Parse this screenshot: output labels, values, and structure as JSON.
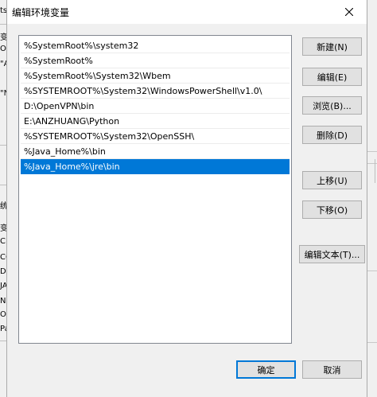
{
  "dialog": {
    "title": "编辑环境变量"
  },
  "paths": [
    "%SystemRoot%\\system32",
    "%SystemRoot%",
    "%SystemRoot%\\System32\\Wbem",
    "%SYSTEMROOT%\\System32\\WindowsPowerShell\\v1.0\\",
    "D:\\OpenVPN\\bin",
    "E:\\ANZHUANG\\Python",
    "%SYSTEMROOT%\\System32\\OpenSSH\\",
    "%Java_Home%\\bin",
    "%Java_Home%\\jre\\bin"
  ],
  "selected_index": 8,
  "buttons": {
    "new": "新建(N)",
    "edit": "编辑(E)",
    "browse": "浏览(B)...",
    "delete": "删除(D)",
    "move_up": "上移(U)",
    "move_down": "下移(O)",
    "edit_text": "编辑文本(T)...",
    "ok": "确定",
    "cancel": "取消"
  },
  "background": {
    "left_fragments": [
      "ts",
      "变",
      "O",
      "\"A",
      "\"N",
      "统",
      "变",
      "CL",
      "CO",
      "D",
      "JA",
      "N",
      "O",
      "Pa"
    ]
  },
  "colors": {
    "selection": "#0078d7",
    "dialog_bg": "#f0f0f0"
  }
}
